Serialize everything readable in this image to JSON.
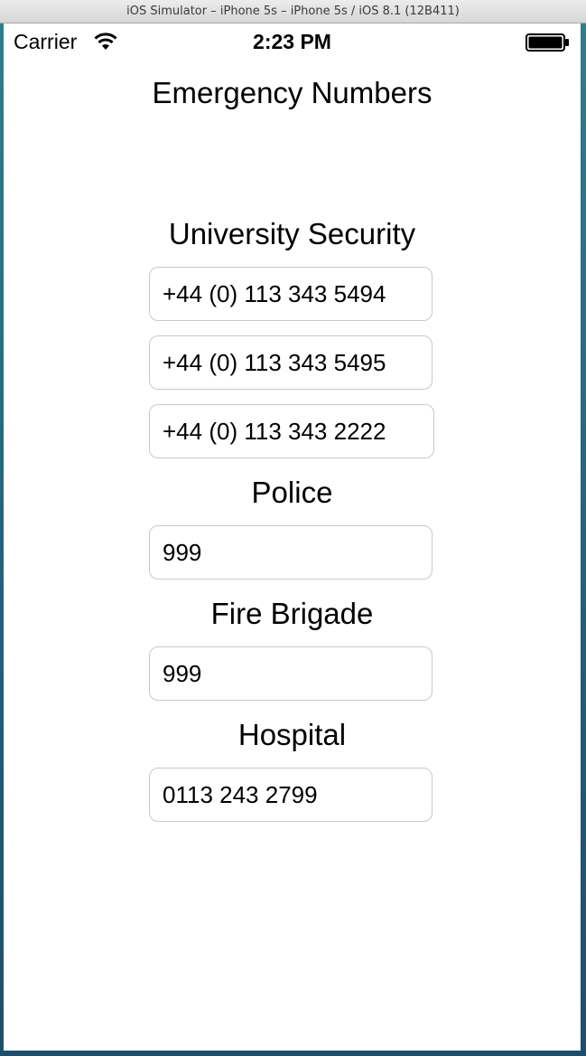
{
  "window": {
    "title": "iOS Simulator – iPhone 5s – iPhone 5s / iOS 8.1 (12B411)"
  },
  "status_bar": {
    "carrier": "Carrier",
    "time": "2:23 PM",
    "wifi_icon": "wifi-icon",
    "battery_icon": "battery-icon"
  },
  "page": {
    "title": "Emergency Numbers"
  },
  "sections": {
    "university_security": {
      "label": "University Security",
      "numbers": [
        "+44 (0) 113 343 5494",
        "+44 (0) 113 343 5495",
        "+44 (0) 113 343 2222"
      ]
    },
    "police": {
      "label": "Police",
      "numbers": [
        "999"
      ]
    },
    "fire_brigade": {
      "label": "Fire Brigade",
      "numbers": [
        "999"
      ]
    },
    "hospital": {
      "label": "Hospital",
      "numbers": [
        "0113 243 2799"
      ]
    }
  }
}
